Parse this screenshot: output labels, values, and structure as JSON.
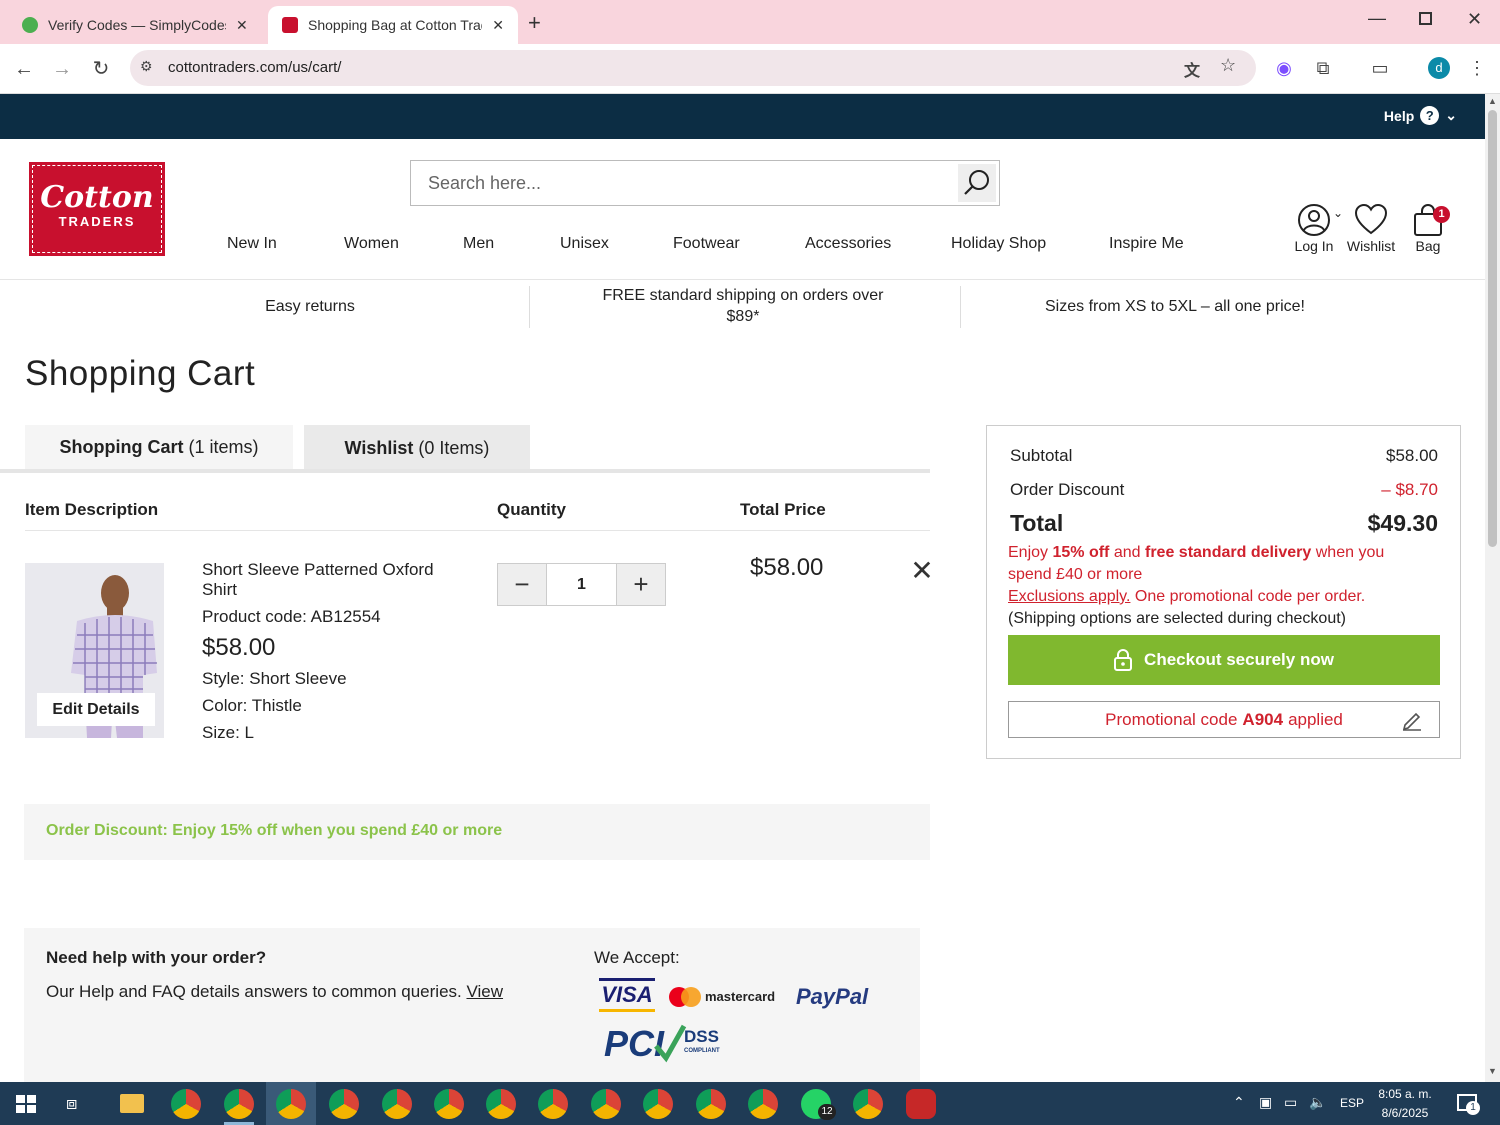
{
  "browser": {
    "tabs": [
      {
        "title": "Verify Codes — SimplyCodes",
        "active": false,
        "favicon_color": "#4caf50"
      },
      {
        "title": "Shopping Bag at Cotton Traders",
        "active": true,
        "favicon_color": "#c8102e"
      }
    ],
    "new_tab_icon": "plus-icon",
    "url": "cottontraders.com/us/cart/",
    "profile_initial": "d"
  },
  "site": {
    "help_label": "Help",
    "logo_line1": "Cotton",
    "logo_line2": "TRADERS",
    "search_placeholder": "Search here...",
    "nav": [
      "New In",
      "Women",
      "Men",
      "Unisex",
      "Footwear",
      "Accessories",
      "Holiday Shop",
      "Inspire Me"
    ],
    "account": {
      "login_label": "Log In",
      "wishlist_label": "Wishlist",
      "bag_label": "Bag",
      "bag_count": "1"
    },
    "benefits": [
      "Easy returns",
      "FREE standard shipping on orders over $89*",
      "Sizes from XS to 5XL – all one price!"
    ]
  },
  "cart": {
    "title": "Shopping Cart",
    "tabs": [
      {
        "label": "Shopping Cart",
        "count": "(1 items)"
      },
      {
        "label": "Wishlist",
        "count": "(0 Items)"
      }
    ],
    "columns": {
      "description": "Item Description",
      "quantity": "Quantity",
      "total": "Total Price"
    },
    "item": {
      "name": "Short Sleeve Patterned Oxford Shirt",
      "product_code": "Product code: AB12554",
      "price": "$58.00",
      "style": "Style: Short Sleeve",
      "color": "Color: Thistle",
      "size": "Size: L",
      "edit_label": "Edit Details",
      "quantity": "1",
      "total_price": "$58.00"
    },
    "order_discount": "Order Discount: Enjoy 15% off when you spend £40 or more",
    "help": {
      "heading": "Need help with your order?",
      "text": "Our Help and FAQ details answers to common queries.",
      "link": "View",
      "we_accept": "We Accept:",
      "payment_methods": [
        "VISA",
        "mastercard",
        "PayPal",
        "PCI DSS COMPLIANT"
      ]
    }
  },
  "summary": {
    "subtotal_label": "Subtotal",
    "subtotal_value": "$58.00",
    "discount_label": "Order Discount",
    "discount_value": "– $8.70",
    "total_label": "Total",
    "total_value": "$49.30",
    "promo_enjoy": "Enjoy",
    "promo_pct": "15% off",
    "promo_and": "and",
    "promo_free": "free standard delivery",
    "promo_when": "when you spend £40 or more",
    "promo_exclusions": "Exclusions apply.",
    "promo_one": "One promotional code per order.",
    "promo_shipping": "(Shipping options are selected during checkout)",
    "checkout_label": "Checkout securely now",
    "promo_code_prefix": "Promotional code",
    "promo_code": "A904",
    "promo_code_suffix": "applied"
  },
  "taskbar": {
    "time": "8:05 a. m.",
    "date": "8/6/2025",
    "language": "ESP",
    "notification_count": "1",
    "whatsapp_badge": "12"
  },
  "colors": {
    "accent_red": "#c8102e",
    "discount_red": "#d0222e",
    "checkout_green": "#80b82f",
    "discount_green": "#8bc34a",
    "header_navy": "#0c2d44"
  }
}
